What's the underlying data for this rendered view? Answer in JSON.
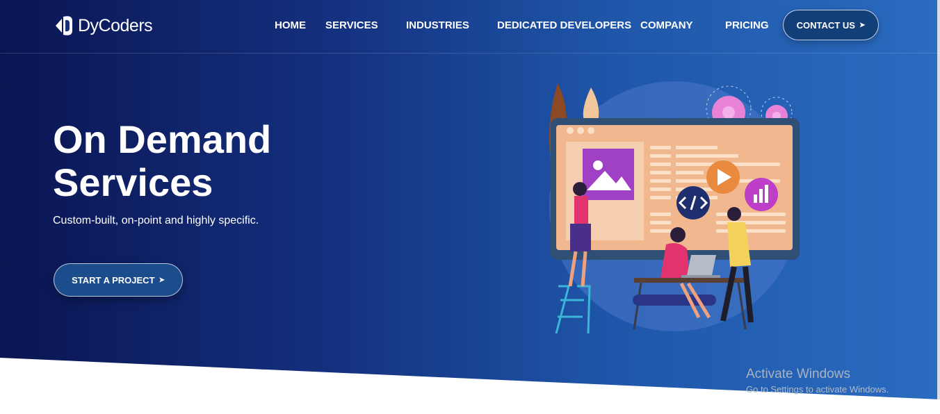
{
  "brand": {
    "name": "DyCoders",
    "logo_icon": "dycoders-logo-icon"
  },
  "nav": {
    "items": [
      {
        "label": "HOME"
      },
      {
        "label": "SERVICES"
      },
      {
        "label": "INDUSTRIES"
      },
      {
        "label": "DEDICATED DEVELOPERS"
      },
      {
        "label": "COMPANY"
      },
      {
        "label": "PRICING"
      }
    ],
    "contact": {
      "label": "CONTACT US",
      "icon": "arrow-right-icon"
    }
  },
  "hero": {
    "title_line1": "On Demand",
    "title_line2": "Services",
    "subtitle": "Custom-built, on-point and highly specific.",
    "cta": {
      "label": "START A PROJECT",
      "icon": "arrow-right-icon"
    }
  },
  "watermark": {
    "title": "Activate Windows",
    "subtitle": "Go to Settings to activate Windows."
  },
  "colors": {
    "gradient_start": "#0a1552",
    "gradient_end": "#2a6cc0",
    "button_bg": "#1b4c8b",
    "text": "#ffffff"
  }
}
